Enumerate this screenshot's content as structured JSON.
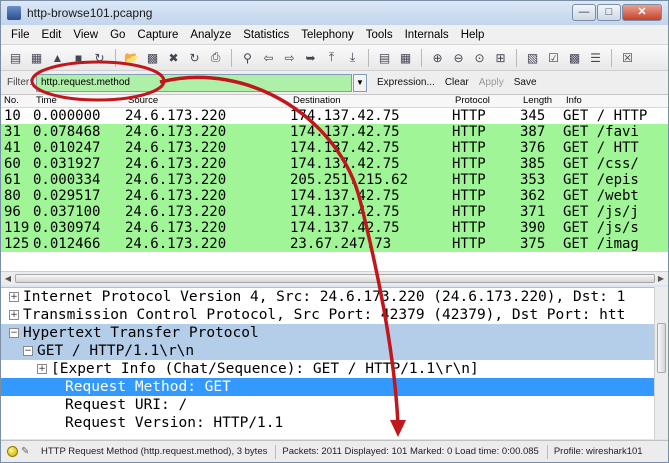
{
  "window": {
    "title": "http-browse101.pcapng"
  },
  "menubar": [
    "File",
    "Edit",
    "View",
    "Go",
    "Capture",
    "Analyze",
    "Statistics",
    "Telephony",
    "Tools",
    "Internals",
    "Help"
  ],
  "filter": {
    "label": "Filter:",
    "value": "http.request.method",
    "buttons": {
      "expression": "Expression...",
      "clear": "Clear",
      "apply": "Apply",
      "save": "Save"
    }
  },
  "packet_list": {
    "columns": [
      "No.",
      "Time",
      "Source",
      "Destination",
      "Protocol",
      "Length",
      "Info"
    ],
    "rows": [
      {
        "no": "10",
        "time": "0.000000",
        "src": "24.6.173.220",
        "dst": "174.137.42.75",
        "proto": "HTTP",
        "len": "345",
        "info": "GET / HTTP",
        "color": "white"
      },
      {
        "no": "31",
        "time": "0.078468",
        "src": "24.6.173.220",
        "dst": "174.137.42.75",
        "proto": "HTTP",
        "len": "387",
        "info": "GET /favi",
        "color": "green"
      },
      {
        "no": "41",
        "time": "0.010247",
        "src": "24.6.173.220",
        "dst": "174.137.42.75",
        "proto": "HTTP",
        "len": "376",
        "info": "GET / HTT",
        "color": "green"
      },
      {
        "no": "60",
        "time": "0.031927",
        "src": "24.6.173.220",
        "dst": "174.137.42.75",
        "proto": "HTTP",
        "len": "385",
        "info": "GET /css/",
        "color": "green"
      },
      {
        "no": "61",
        "time": "0.000334",
        "src": "24.6.173.220",
        "dst": "205.251.215.62",
        "proto": "HTTP",
        "len": "353",
        "info": "GET /epis",
        "color": "green"
      },
      {
        "no": "80",
        "time": "0.029517",
        "src": "24.6.173.220",
        "dst": "174.137.42.75",
        "proto": "HTTP",
        "len": "362",
        "info": "GET /webt",
        "color": "green"
      },
      {
        "no": "96",
        "time": "0.037100",
        "src": "24.6.173.220",
        "dst": "174.137.42.75",
        "proto": "HTTP",
        "len": "371",
        "info": "GET /js/j",
        "color": "green"
      },
      {
        "no": "119",
        "time": "0.030974",
        "src": "24.6.173.220",
        "dst": "174.137.42.75",
        "proto": "HTTP",
        "len": "390",
        "info": "GET /js/s",
        "color": "green"
      },
      {
        "no": "125",
        "time": "0.012466",
        "src": "24.6.173.220",
        "dst": "23.67.247.73",
        "proto": "HTTP",
        "len": "375",
        "info": "GET /imag",
        "color": "green"
      }
    ]
  },
  "details": [
    {
      "text": "Internet Protocol Version 4, Src: 24.6.173.220 (24.6.173.220), Dst: 1",
      "expander": "+",
      "indent": 0,
      "state": "normal"
    },
    {
      "text": "Transmission Control Protocol, Src Port: 42379 (42379), Dst Port: htt",
      "expander": "+",
      "indent": 0,
      "state": "normal"
    },
    {
      "text": "Hypertext Transfer Protocol",
      "expander": "−",
      "indent": 0,
      "state": "sel-light"
    },
    {
      "text": "GET / HTTP/1.1\\r\\n",
      "expander": "−",
      "indent": 1,
      "state": "sel-light"
    },
    {
      "text": "[Expert Info (Chat/Sequence): GET / HTTP/1.1\\r\\n]",
      "expander": "+",
      "indent": 2,
      "state": "normal"
    },
    {
      "text": "Request Method: GET",
      "expander": "",
      "indent": 3,
      "state": "sel"
    },
    {
      "text": "Request URI: /",
      "expander": "",
      "indent": 3,
      "state": "normal"
    },
    {
      "text": "Request Version: HTTP/1.1",
      "expander": "",
      "indent": 3,
      "state": "normal"
    }
  ],
  "statusbar": {
    "field_info": "HTTP Request Method (http.request.method), 3 bytes",
    "counts": "Packets: 2011 Displayed: 101 Marked: 0 Load time: 0:00.085",
    "profile": "Profile: wireshark101"
  },
  "colors": {
    "filter_ok": "#aff0a8",
    "row_green": "#a0f596",
    "selection": "#3399ff",
    "annotation": "#c0171c"
  },
  "icons": [
    "open-icon",
    "save-icon",
    "close-file-icon",
    "reload-icon",
    "print-icon",
    "find-icon",
    "back-icon",
    "forward-icon",
    "goto-icon",
    "first-icon",
    "last-icon",
    "colorize-icon",
    "autoscroll-icon",
    "zoom-in-icon",
    "zoom-out-icon",
    "zoom-normal-icon",
    "resize-icon",
    "capture-filter-icon",
    "display-filter-icon",
    "coloring-rules-icon",
    "prefs-icon",
    "help-icon"
  ]
}
